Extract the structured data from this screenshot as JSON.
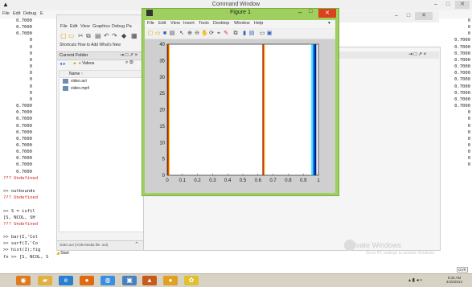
{
  "command_window": {
    "title": "Command Window",
    "menu": [
      "File",
      "Edit",
      "Debug",
      "E"
    ],
    "right_buttons": [
      "–",
      "□",
      "✕"
    ]
  },
  "left_output": {
    "top_lines": [
      "0.7000",
      "0.7000",
      "0.7000",
      "0",
      "0",
      "0",
      "0",
      "0",
      "0",
      "0",
      "0",
      "0",
      "0",
      "0.7000",
      "0.7000",
      "0.7000",
      "0.7000",
      "0.7000",
      "0.7000",
      "0.7000",
      "0.7000",
      "0.7000",
      "0.7000",
      "0.7000"
    ],
    "undefined_1": "??? Undefined",
    "blank": "",
    "cmd_outbounds": ">> outbounds",
    "undefined_2": "??? Undefined",
    "cmd_s": ">> S = isfil",
    "cmd_s2": "[S, NCOL, SH",
    "undefined_3": "??? Undefined",
    "cmd_bar": ">> bar(I,'Col",
    "cmd_surf": ">> surf(I,'Co",
    "cmd_hist": ">> hist(I);fig",
    "cmd_last": "fx >> [S, NCOL, S"
  },
  "right_output": {
    "lines": [
      "0",
      "0",
      "0",
      "0.7000",
      "0.7000",
      "0.7000",
      "0.7000",
      "0.7000",
      "0.7000",
      "0.7000",
      "0.7000",
      "0.7000",
      "0.7000",
      "0.7000",
      "0",
      "0",
      "0",
      "0",
      "0",
      "0",
      "0",
      "0",
      "0"
    ]
  },
  "current_folder": {
    "menu": [
      "File",
      "Edit",
      "View",
      "Graphics",
      "Debug",
      "Pa"
    ],
    "shortcuts": "Shortcuts  How to Add  What's New",
    "header": "Current Folder",
    "path": "« Videos",
    "column_name": "Name ↑",
    "files": [
      "video.avi",
      "video.mp4"
    ],
    "footer": "video.avi (VOB Media file .avi)"
  },
  "back_window": {
    "buttons": [
      "–",
      "□",
      "✕"
    ]
  },
  "figure": {
    "title": "Figure 1",
    "menu": [
      "File",
      "Edit",
      "View",
      "Insert",
      "Tools",
      "Desktop",
      "Window",
      "Help"
    ]
  },
  "chart_data": {
    "type": "heatmap",
    "x_ticks": [
      "0",
      "0.1",
      "0.2",
      "0.3",
      "0.4",
      "0.5",
      "0.6",
      "0.7",
      "0.8",
      "0.9",
      "1"
    ],
    "y_ticks": [
      "0",
      "5",
      "10",
      "15",
      "20",
      "25",
      "30",
      "35",
      "40"
    ],
    "xlim": [
      0,
      1
    ],
    "ylim": [
      0,
      40
    ],
    "bands": [
      {
        "x0": 0.0,
        "x1": 0.015,
        "colors": [
          "#7a0000",
          "#cc1a00",
          "#ff6a00",
          "#ffd000"
        ]
      },
      {
        "x0": 0.63,
        "x1": 0.645,
        "colors": [
          "#7a0000",
          "#cc1a00",
          "#ff6a00",
          "#ffd000"
        ]
      },
      {
        "x0": 0.94,
        "x1": 0.985,
        "colors": [
          "#ffffff",
          "#66e0ff",
          "#0088ee",
          "#001a90"
        ]
      }
    ]
  },
  "watermark": {
    "title": "Activate Windows",
    "subtitle": "Go to PC settings to activate Windows."
  },
  "start_button": "Start",
  "taskbar": {
    "icons": [
      "ie-icon",
      "folder-icon",
      "ie-icon",
      "chrome-icon",
      "photo-icon",
      "matlab-icon",
      "media-icon",
      "paint-icon"
    ],
    "clock_time": "9:33 AM",
    "clock_date": "4/15/2014"
  },
  "ovr": "OVR"
}
